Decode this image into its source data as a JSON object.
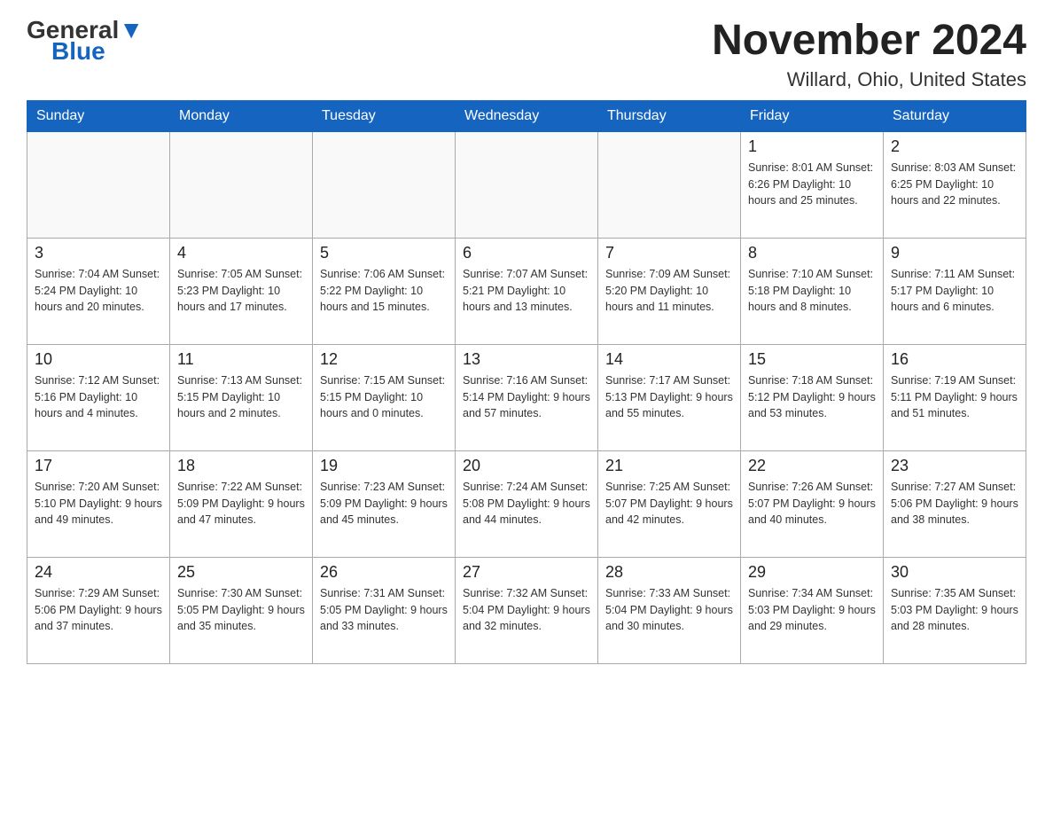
{
  "header": {
    "logo_general": "General",
    "logo_blue": "Blue",
    "main_title": "November 2024",
    "sub_title": "Willard, Ohio, United States"
  },
  "weekdays": [
    "Sunday",
    "Monday",
    "Tuesday",
    "Wednesday",
    "Thursday",
    "Friday",
    "Saturday"
  ],
  "weeks": [
    [
      {
        "day": "",
        "info": ""
      },
      {
        "day": "",
        "info": ""
      },
      {
        "day": "",
        "info": ""
      },
      {
        "day": "",
        "info": ""
      },
      {
        "day": "",
        "info": ""
      },
      {
        "day": "1",
        "info": "Sunrise: 8:01 AM\nSunset: 6:26 PM\nDaylight: 10 hours\nand 25 minutes."
      },
      {
        "day": "2",
        "info": "Sunrise: 8:03 AM\nSunset: 6:25 PM\nDaylight: 10 hours\nand 22 minutes."
      }
    ],
    [
      {
        "day": "3",
        "info": "Sunrise: 7:04 AM\nSunset: 5:24 PM\nDaylight: 10 hours\nand 20 minutes."
      },
      {
        "day": "4",
        "info": "Sunrise: 7:05 AM\nSunset: 5:23 PM\nDaylight: 10 hours\nand 17 minutes."
      },
      {
        "day": "5",
        "info": "Sunrise: 7:06 AM\nSunset: 5:22 PM\nDaylight: 10 hours\nand 15 minutes."
      },
      {
        "day": "6",
        "info": "Sunrise: 7:07 AM\nSunset: 5:21 PM\nDaylight: 10 hours\nand 13 minutes."
      },
      {
        "day": "7",
        "info": "Sunrise: 7:09 AM\nSunset: 5:20 PM\nDaylight: 10 hours\nand 11 minutes."
      },
      {
        "day": "8",
        "info": "Sunrise: 7:10 AM\nSunset: 5:18 PM\nDaylight: 10 hours\nand 8 minutes."
      },
      {
        "day": "9",
        "info": "Sunrise: 7:11 AM\nSunset: 5:17 PM\nDaylight: 10 hours\nand 6 minutes."
      }
    ],
    [
      {
        "day": "10",
        "info": "Sunrise: 7:12 AM\nSunset: 5:16 PM\nDaylight: 10 hours\nand 4 minutes."
      },
      {
        "day": "11",
        "info": "Sunrise: 7:13 AM\nSunset: 5:15 PM\nDaylight: 10 hours\nand 2 minutes."
      },
      {
        "day": "12",
        "info": "Sunrise: 7:15 AM\nSunset: 5:15 PM\nDaylight: 10 hours\nand 0 minutes."
      },
      {
        "day": "13",
        "info": "Sunrise: 7:16 AM\nSunset: 5:14 PM\nDaylight: 9 hours\nand 57 minutes."
      },
      {
        "day": "14",
        "info": "Sunrise: 7:17 AM\nSunset: 5:13 PM\nDaylight: 9 hours\nand 55 minutes."
      },
      {
        "day": "15",
        "info": "Sunrise: 7:18 AM\nSunset: 5:12 PM\nDaylight: 9 hours\nand 53 minutes."
      },
      {
        "day": "16",
        "info": "Sunrise: 7:19 AM\nSunset: 5:11 PM\nDaylight: 9 hours\nand 51 minutes."
      }
    ],
    [
      {
        "day": "17",
        "info": "Sunrise: 7:20 AM\nSunset: 5:10 PM\nDaylight: 9 hours\nand 49 minutes."
      },
      {
        "day": "18",
        "info": "Sunrise: 7:22 AM\nSunset: 5:09 PM\nDaylight: 9 hours\nand 47 minutes."
      },
      {
        "day": "19",
        "info": "Sunrise: 7:23 AM\nSunset: 5:09 PM\nDaylight: 9 hours\nand 45 minutes."
      },
      {
        "day": "20",
        "info": "Sunrise: 7:24 AM\nSunset: 5:08 PM\nDaylight: 9 hours\nand 44 minutes."
      },
      {
        "day": "21",
        "info": "Sunrise: 7:25 AM\nSunset: 5:07 PM\nDaylight: 9 hours\nand 42 minutes."
      },
      {
        "day": "22",
        "info": "Sunrise: 7:26 AM\nSunset: 5:07 PM\nDaylight: 9 hours\nand 40 minutes."
      },
      {
        "day": "23",
        "info": "Sunrise: 7:27 AM\nSunset: 5:06 PM\nDaylight: 9 hours\nand 38 minutes."
      }
    ],
    [
      {
        "day": "24",
        "info": "Sunrise: 7:29 AM\nSunset: 5:06 PM\nDaylight: 9 hours\nand 37 minutes."
      },
      {
        "day": "25",
        "info": "Sunrise: 7:30 AM\nSunset: 5:05 PM\nDaylight: 9 hours\nand 35 minutes."
      },
      {
        "day": "26",
        "info": "Sunrise: 7:31 AM\nSunset: 5:05 PM\nDaylight: 9 hours\nand 33 minutes."
      },
      {
        "day": "27",
        "info": "Sunrise: 7:32 AM\nSunset: 5:04 PM\nDaylight: 9 hours\nand 32 minutes."
      },
      {
        "day": "28",
        "info": "Sunrise: 7:33 AM\nSunset: 5:04 PM\nDaylight: 9 hours\nand 30 minutes."
      },
      {
        "day": "29",
        "info": "Sunrise: 7:34 AM\nSunset: 5:03 PM\nDaylight: 9 hours\nand 29 minutes."
      },
      {
        "day": "30",
        "info": "Sunrise: 7:35 AM\nSunset: 5:03 PM\nDaylight: 9 hours\nand 28 minutes."
      }
    ]
  ]
}
